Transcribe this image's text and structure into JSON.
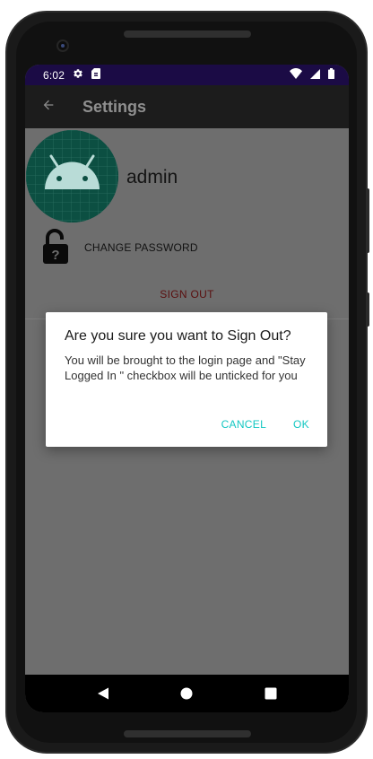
{
  "status_bar": {
    "time": "6:02",
    "icons": [
      "settings-icon",
      "sim-card-icon",
      "wifi-icon",
      "signal-icon",
      "battery-icon"
    ]
  },
  "toolbar": {
    "title": "Settings",
    "back_icon": "arrow-back-icon"
  },
  "profile": {
    "avatar_icon": "android-robot-icon",
    "username": "admin"
  },
  "menu": {
    "change_password_label": "CHANGE PASSWORD",
    "lock_icon": "unlocked-padlock-question-icon",
    "sign_out_label": "SIGN OUT"
  },
  "dialog": {
    "title": "Are you sure you want to Sign Out?",
    "message": "You will be brought to the login page and \"Stay Logged In \" checkbox will be unticked for you",
    "cancel_label": "CANCEL",
    "ok_label": "OK"
  },
  "navbar": {
    "icons": [
      "nav-back-icon",
      "nav-home-icon",
      "nav-recent-icon"
    ]
  },
  "colors": {
    "status_bar": "#1b0b45",
    "dialog_button": "#13c7c2",
    "sign_out": "#5a0f0f",
    "avatar_bg": "#0c4f42",
    "android_head": "#b9dcd7"
  }
}
